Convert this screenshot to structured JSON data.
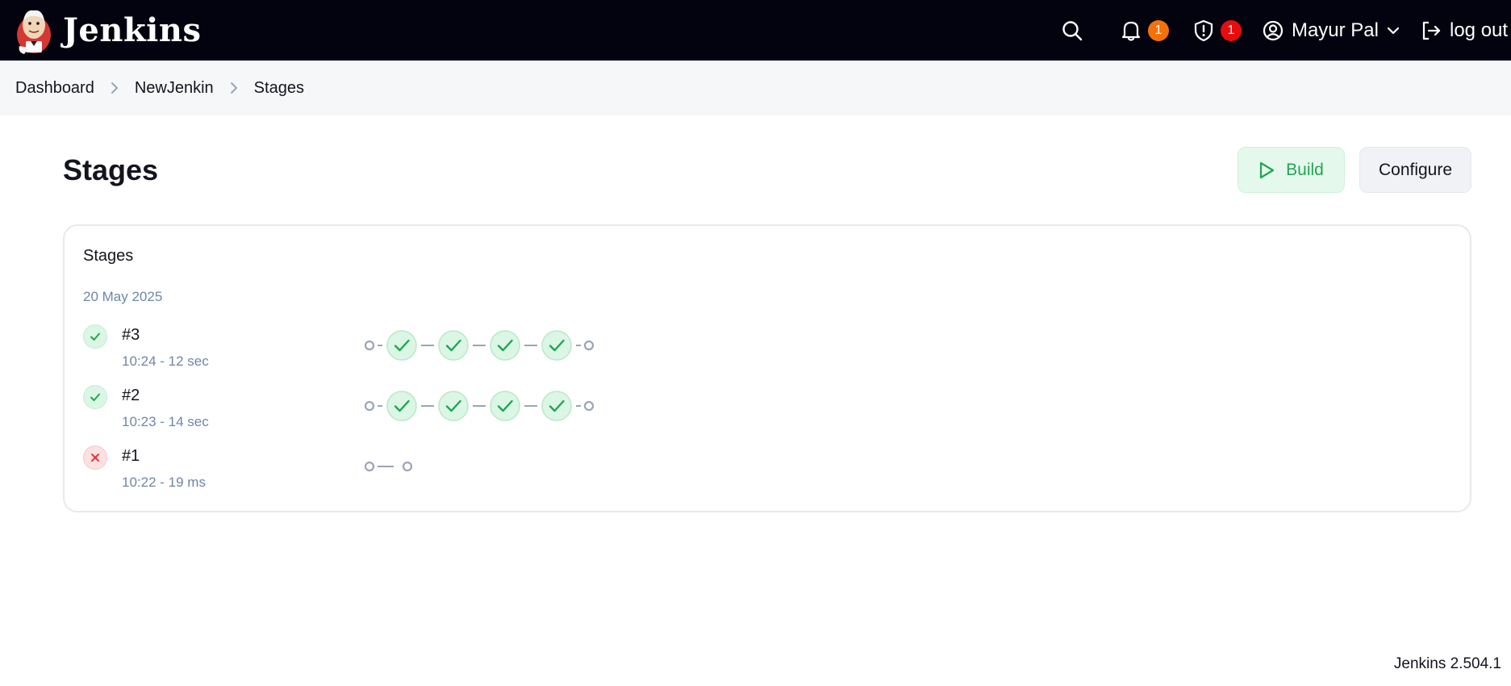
{
  "header": {
    "brand": "Jenkins",
    "search_icon": "search-icon",
    "notifications": {
      "icon": "bell-icon",
      "count": "1",
      "color": "#f47109"
    },
    "security": {
      "icon": "shield-alert-icon",
      "count": "1",
      "color": "#e80d0d"
    },
    "user": {
      "name": "Mayur Pal",
      "icon": "user-circle-icon"
    },
    "logout": {
      "label": "log out",
      "icon": "logout-icon"
    }
  },
  "breadcrumb": {
    "items": [
      "Dashboard",
      "NewJenkin",
      "Stages"
    ]
  },
  "page": {
    "title": "Stages",
    "build_label": "Build",
    "configure_label": "Configure"
  },
  "stages_card": {
    "title": "Stages",
    "date": "20 May 2025",
    "runs": [
      {
        "id": "#3",
        "meta": "10:24 - 12 sec",
        "status": "success",
        "stages": [
          "success",
          "success",
          "success",
          "success"
        ]
      },
      {
        "id": "#2",
        "meta": "10:23 - 14 sec",
        "status": "success",
        "stages": [
          "success",
          "success",
          "success",
          "success"
        ]
      },
      {
        "id": "#1",
        "meta": "10:22 - 19 ms",
        "status": "failed",
        "stages": []
      }
    ]
  },
  "footer": {
    "version": "Jenkins 2.504.1"
  },
  "colors": {
    "topbar": "#02030f",
    "success": "#1fa653",
    "success_bg": "#dcf6e5",
    "failure": "#e0383e",
    "failure_bg": "#fde0e0",
    "muted": "#6f86a8"
  }
}
